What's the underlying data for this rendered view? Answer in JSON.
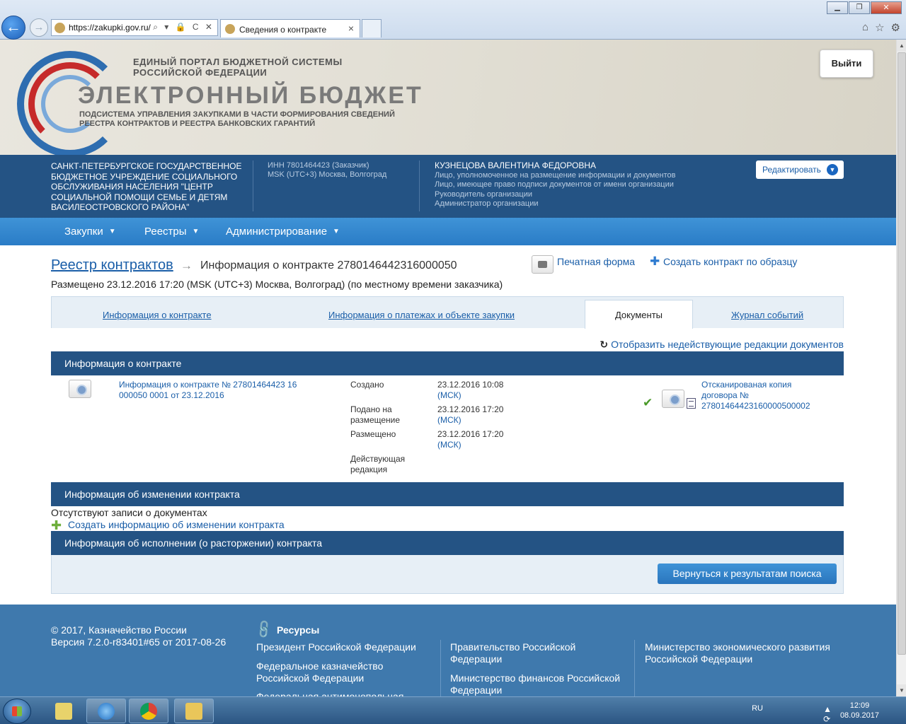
{
  "browser": {
    "url": "https://zakupki.gov.ru/",
    "url_controls": "⌕ ▾ 🔒 C ✕",
    "tab_title": "Сведения о контракте",
    "tab_close": "×",
    "back_glyph": "←",
    "fwd_glyph": "→",
    "win_min": "▁",
    "win_max": "❐",
    "win_close": "✕",
    "tool_home": "⌂",
    "tool_star": "☆",
    "tool_gear": "⚙"
  },
  "header": {
    "line1": "ЕДИНЫЙ ПОРТАЛ БЮДЖЕТНОЙ СИСТЕМЫ",
    "line2": "РОССИЙСКОЙ ФЕДЕРАЦИИ",
    "big": "ЭЛЕКТРОННЫЙ БЮДЖЕТ",
    "sub1": "ПОДСИСТЕМА УПРАВЛЕНИЯ ЗАКУПКАМИ В ЧАСТИ ФОРМИРОВАНИЯ СВЕДЕНИЙ",
    "sub2": "РЕЕСТРА КОНТРАКТОВ И РЕЕСТРА БАНКОВСКИХ ГАРАНТИЙ",
    "logout": "Выйти"
  },
  "org": {
    "name_lines": [
      "САНКТ-ПЕТЕРБУРГСКОЕ ГОСУДАРСТВЕННОЕ",
      "БЮДЖЕТНОЕ УЧРЕЖДЕНИЕ СОЦИАЛЬНОГО",
      "ОБСЛУЖИВАНИЯ НАСЕЛЕНИЯ \"ЦЕНТР",
      "СОЦИАЛЬНОЙ ПОМОЩИ СЕМЬЕ И ДЕТЯМ",
      "ВАСИЛЕОСТРОВСКОГО РАЙОНА\""
    ],
    "inn": "ИНН 7801464423 (Заказчик)",
    "tz": "MSK (UTC+3) Москва, Волгоград",
    "user": "КУЗНЕЦОВА ВАЛЕНТИНА ФЕДОРОВНА",
    "roles": [
      "Лицо, уполномоченное на размещение информации и документов",
      "Лицо, имеющее право подписи документов от имени организации",
      "Руководитель организации",
      "Администратор организации"
    ],
    "edit_label": "Редактировать",
    "edit_glyph": "▼"
  },
  "menu": [
    {
      "label": "Закупки",
      "caret": "▼"
    },
    {
      "label": "Реестры",
      "caret": "▼"
    },
    {
      "label": "Администрирование",
      "caret": "▼"
    }
  ],
  "page": {
    "breadcrumb_root": "Реестр контрактов",
    "breadcrumb_arrow": "→",
    "breadcrumb_current": "Информация о контракте 2780146442316000050",
    "print_label": "Печатная форма",
    "create_plus": "✚",
    "create_label": "Создать контракт по образцу",
    "posted": "Размещено 23.12.2016 17:20 (MSK (UTC+3) Москва, Волгоград) (по местному времени заказчика)"
  },
  "tabs": {
    "info": "Информация о контракте",
    "payments": "Информация о платежах и объекте закупки",
    "documents": "Документы",
    "journal": "Журнал событий"
  },
  "show_inactive": {
    "glyph": "↻",
    "label": "Отобразить недействующие редакции документов"
  },
  "section_info": {
    "title": "Информация о контракте",
    "doc_link_lines": [
      "Информация о контракте № 27801464423 16",
      "000050 0001 от 23.12.2016"
    ],
    "created_label": "Создано",
    "created_value": "23.12.2016 10:08",
    "submitted_label_lines": [
      "Подано на",
      "размещение"
    ],
    "submitted_value": "23.12.2016 17:20",
    "posted_label": "Размещено",
    "posted_value": "23.12.2016 17:20",
    "tz_short": "(МСК)",
    "current_label_lines": [
      "Действующая",
      "редакция"
    ],
    "check_glyph": "✔",
    "scan_link_lines": [
      "Отсканированая копия",
      "договора №",
      "27801464423160000500002"
    ]
  },
  "section_change": {
    "title": "Информация об изменении контракта",
    "no_records": "Отсутствуют записи о документах",
    "plus_glyph": "✚",
    "create_label": "Создать информацию об изменении контракта"
  },
  "section_exec": {
    "title": "Информация об исполнении (о расторжении) контракта",
    "back_label": "Вернуться к результатам поиска"
  },
  "footer": {
    "copyright": "© 2017, Казначейство России",
    "version": "Версия 7.2.0-r83401#65 от 2017-08-26",
    "resources_glyph": "🔗",
    "resources_title": "Ресурсы",
    "col1": [
      "Президент Российской Федерации",
      "Федеральное казначейство",
      "Российской Федерации",
      "Федеральная антимонопольная"
    ],
    "col2": [
      "Правительство Российской",
      "Федерации",
      "Министерство финансов Российской",
      "Федерации"
    ],
    "col3": [
      "Министерство экономического развития",
      "Российской Федерации"
    ]
  },
  "scrollbar": {
    "up": "▲",
    "down": "▼"
  },
  "taskbar": {
    "lang": "RU",
    "tray_icons": "▲ ⟳ ⊡ 🔊",
    "time": "12:09",
    "date": "08.09.2017"
  }
}
